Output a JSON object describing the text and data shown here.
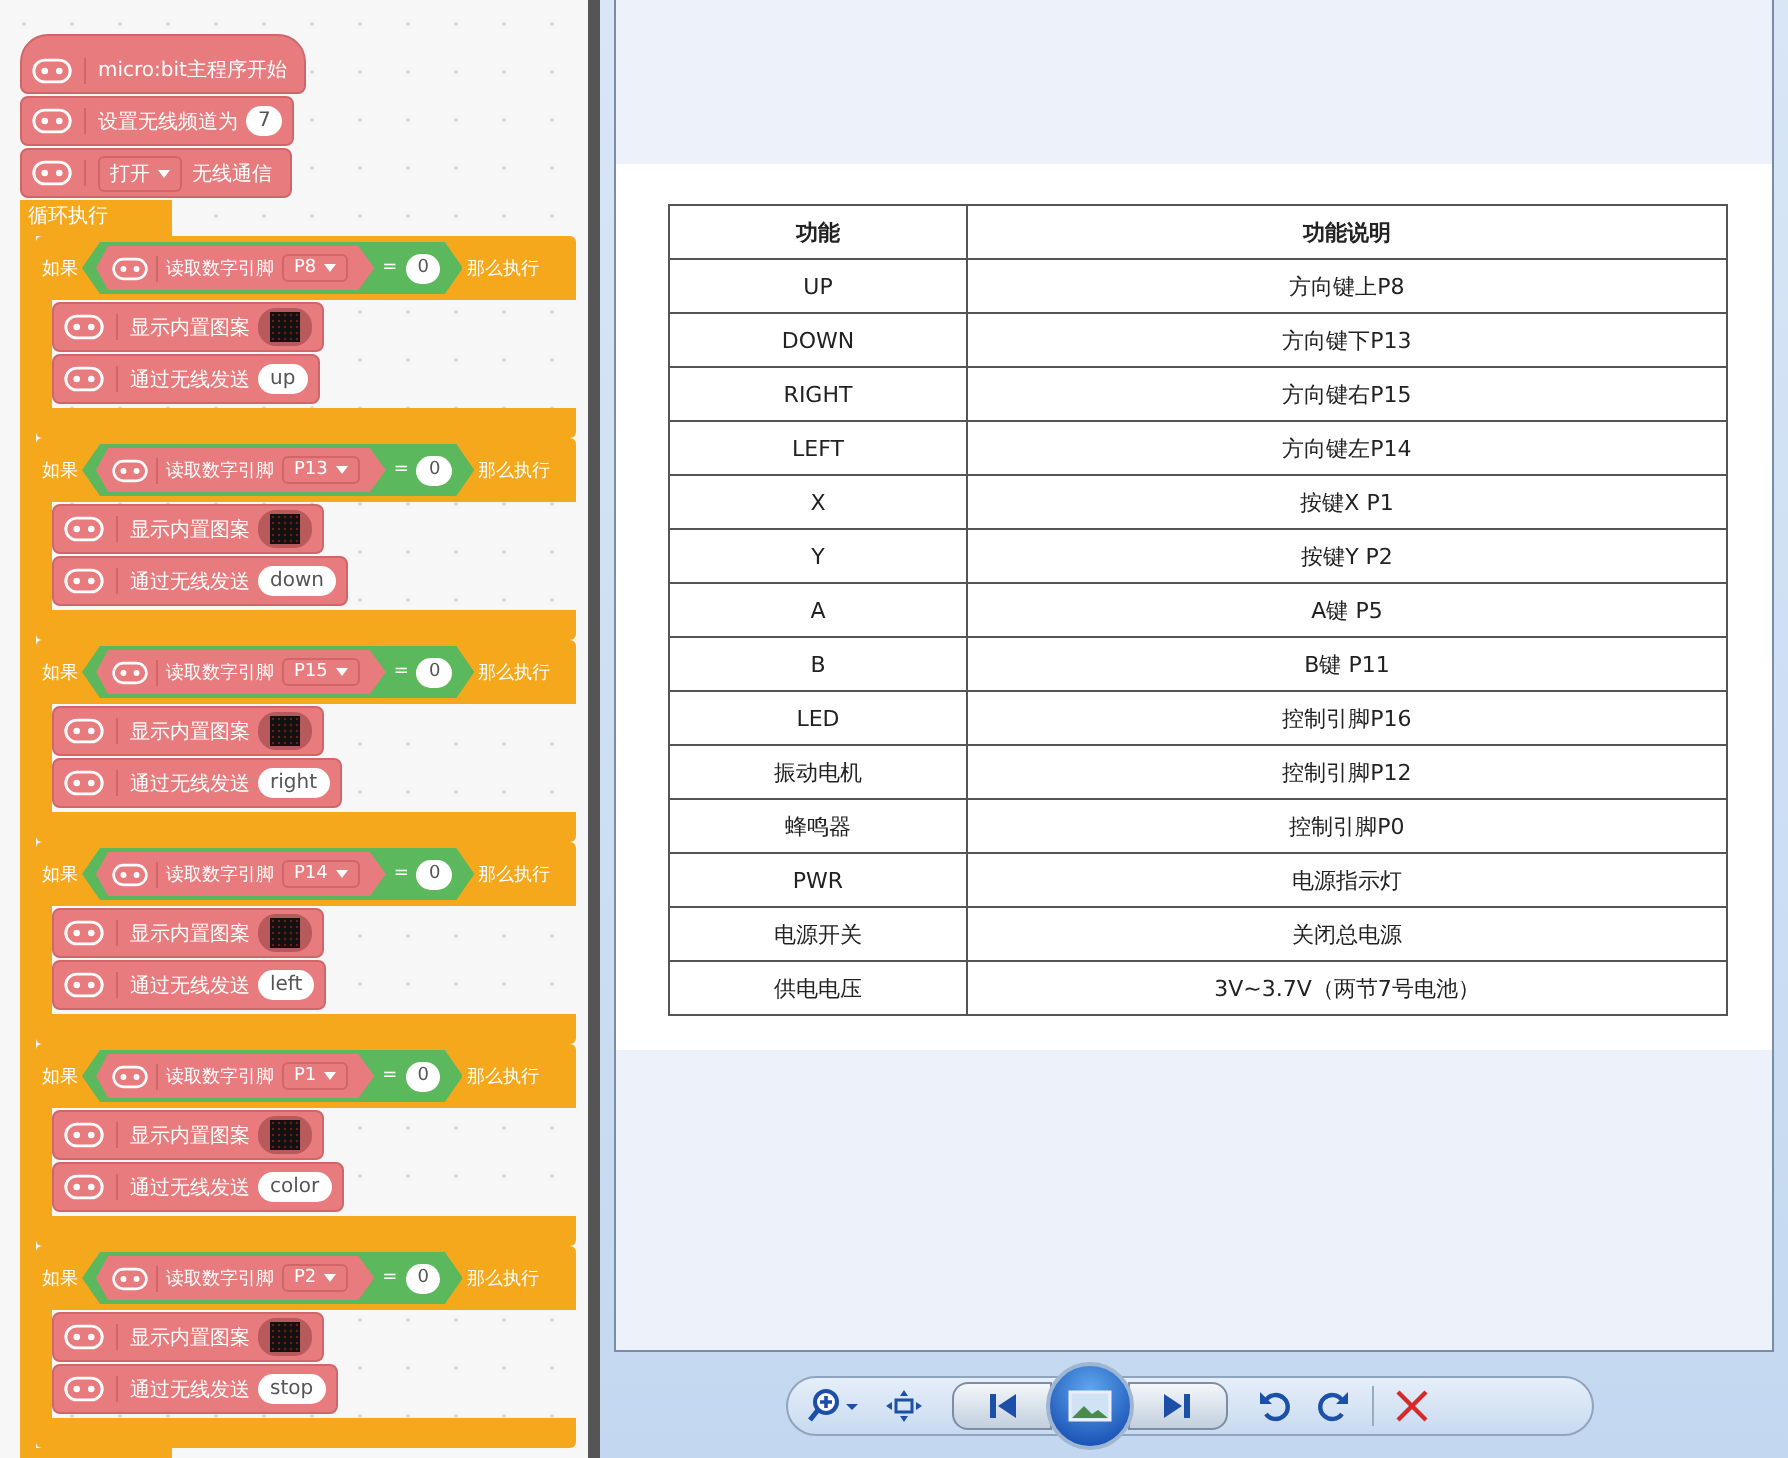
{
  "editor": {
    "header_blocks": [
      {
        "kind": "start",
        "label": "micro:bit主程序开始"
      },
      {
        "kind": "value",
        "label": "设置无线频道为",
        "value": "7"
      },
      {
        "kind": "dropdown",
        "dropdown": "打开",
        "label": "无线通信"
      }
    ],
    "loop": {
      "label": "循环执行",
      "branches": [
        {
          "if": "如果",
          "read": "读取数字引脚",
          "pin": "P8",
          "op": "=",
          "value": "0",
          "then": "那么执行",
          "show": "显示内置图案",
          "send": "通过无线发送",
          "message": "up"
        },
        {
          "if": "如果",
          "read": "读取数字引脚",
          "pin": "P13",
          "op": "=",
          "value": "0",
          "then": "那么执行",
          "show": "显示内置图案",
          "send": "通过无线发送",
          "message": "down"
        },
        {
          "if": "如果",
          "read": "读取数字引脚",
          "pin": "P15",
          "op": "=",
          "value": "0",
          "then": "那么执行",
          "show": "显示内置图案",
          "send": "通过无线发送",
          "message": "right"
        },
        {
          "if": "如果",
          "read": "读取数字引脚",
          "pin": "P14",
          "op": "=",
          "value": "0",
          "then": "那么执行",
          "show": "显示内置图案",
          "send": "通过无线发送",
          "message": "left"
        },
        {
          "if": "如果",
          "read": "读取数字引脚",
          "pin": "P1",
          "op": "=",
          "value": "0",
          "then": "那么执行",
          "show": "显示内置图案",
          "send": "通过无线发送",
          "message": "color"
        },
        {
          "if": "如果",
          "read": "读取数字引脚",
          "pin": "P2",
          "op": "=",
          "value": "0",
          "then": "那么执行",
          "show": "显示内置图案",
          "send": "通过无线发送",
          "message": "stop"
        }
      ]
    }
  },
  "viewer": {
    "table": {
      "columns": [
        "功能",
        "功能说明"
      ],
      "rows": [
        [
          "UP",
          "方向键上P8"
        ],
        [
          "DOWN",
          "方向键下P13"
        ],
        [
          "RIGHT",
          "方向键右P15"
        ],
        [
          "LEFT",
          "方向键左P14"
        ],
        [
          "X",
          "按键X P1"
        ],
        [
          "Y",
          "按键Y P2"
        ],
        [
          "A",
          "A键 P5"
        ],
        [
          "B",
          "B键 P11"
        ],
        [
          "LED",
          "控制引脚P16"
        ],
        [
          "振动电机",
          "控制引脚P12"
        ],
        [
          "蜂鸣器",
          "控制引脚P0"
        ],
        [
          "PWR",
          "电源指示灯"
        ],
        [
          "电源开关",
          "关闭总电源"
        ],
        [
          "供电电压",
          "3V~3.7V（两节7号电池）"
        ]
      ]
    }
  }
}
